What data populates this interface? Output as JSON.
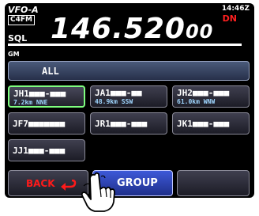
{
  "header": {
    "vfo": "VFO-A",
    "mode": "C4FM",
    "time": "14:46Z",
    "dn": "DN",
    "frequency_main": "146.520",
    "frequency_small": "00",
    "sql": "SQL"
  },
  "group_monitor": {
    "label": "GM",
    "all_label": "ALL",
    "stations": [
      {
        "call": "JH1■■■-■■■",
        "info": "7.2km  NNE"
      },
      {
        "call": "JA1■■■-■■",
        "info": "48.9km  SSW"
      },
      {
        "call": "JH2■■■-■■■",
        "info": "61.0km  WNW"
      },
      {
        "call": "JF7■■■■■■■"
      },
      {
        "call": "JR1■■■-■■■"
      },
      {
        "call": "JK1■■■-■■■"
      },
      {
        "call": "JJ1■■■-■■■"
      }
    ]
  },
  "footer": {
    "back_label": "BACK",
    "group_label": "GROUP"
  },
  "colors": {
    "dn": "#ff2020",
    "back_text": "#ff1a1a",
    "selected_border": "#7fff7f",
    "group_button": "#3d59d8"
  },
  "icons": [
    "return-arrow-icon",
    "pointing-hand-icon"
  ]
}
